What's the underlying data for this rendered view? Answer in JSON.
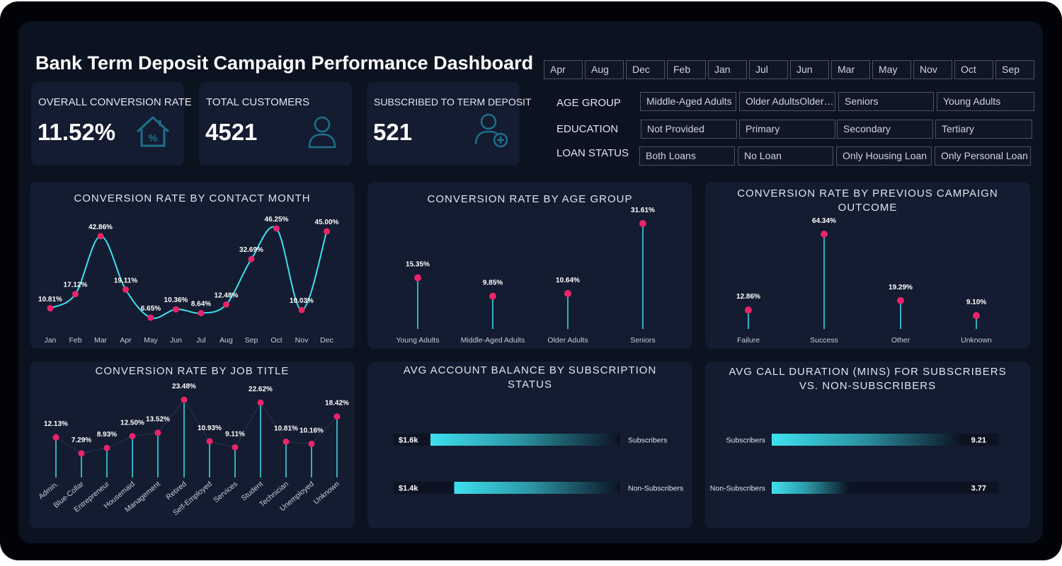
{
  "title": "Bank Term Deposit Campaign Performance Dashboard",
  "kpis": [
    {
      "label": "OVERALL CONVERSION RATE",
      "value": "11.52%",
      "icon": "house-percent-icon"
    },
    {
      "label": "TOTAL CUSTOMERS",
      "value": "4521",
      "icon": "user-icon"
    },
    {
      "label": "SUBSCRIBED TO TERM DEPOSIT",
      "value": "521",
      "icon": "user-add-icon"
    }
  ],
  "month_slicer": [
    "Apr",
    "Aug",
    "Dec",
    "Feb",
    "Jan",
    "Jul",
    "Jun",
    "Mar",
    "May",
    "Nov",
    "Oct",
    "Sep"
  ],
  "filters": {
    "age_group": {
      "label": "AGE GROUP",
      "options": [
        "Middle-Aged Adults",
        "Older AdultsOlder Adults",
        "Seniors",
        "Young Adults"
      ]
    },
    "education": {
      "label": "EDUCATION",
      "options": [
        "Not Provided",
        "Primary",
        "Secondary",
        "Tertiary"
      ]
    },
    "loan_status": {
      "label": "LOAN STATUS",
      "options": [
        "Both Loans",
        "No Loan",
        "Only Housing Loan",
        "Only Personal Loan"
      ]
    }
  },
  "colors": {
    "accent": "#3ee0ef",
    "point": "#e8246a",
    "card": "#131c30",
    "background": "#0b1220"
  },
  "chart_data": [
    {
      "id": "month",
      "type": "line",
      "title": "CONVERSION RATE BY CONTACT MONTH",
      "categories": [
        "Jan",
        "Feb",
        "Mar",
        "Apr",
        "May",
        "Jun",
        "Jul",
        "Aug",
        "Sep",
        "Oct",
        "Nov",
        "Dec"
      ],
      "values": [
        10.81,
        17.12,
        42.86,
        19.11,
        6.65,
        10.36,
        8.64,
        12.48,
        32.69,
        46.25,
        10.03,
        45.0
      ],
      "labels": [
        "10.81%",
        "17.12%",
        "42.86%",
        "19.11%",
        "6.65%",
        "10.36%",
        "8.64%",
        "12.48%",
        "32.69%",
        "46.25%",
        "10.03%",
        "45.00%"
      ]
    },
    {
      "id": "age",
      "type": "lollipop",
      "title": "CONVERSION RATE BY AGE GROUP",
      "categories": [
        "Young Adults",
        "Middle-Aged Adults",
        "Older Adults",
        "Seniors"
      ],
      "values": [
        15.35,
        9.85,
        10.64,
        31.61
      ],
      "labels": [
        "15.35%",
        "9.85%",
        "10.64%",
        "31.61%"
      ]
    },
    {
      "id": "outcome",
      "type": "lollipop",
      "title": "CONVERSION RATE BY PREVIOUS CAMPAIGN\nOUTCOME",
      "categories": [
        "Failure",
        "Success",
        "Other",
        "Unknown"
      ],
      "values": [
        12.86,
        64.34,
        19.29,
        9.1
      ],
      "labels": [
        "12.86%",
        "64.34%",
        "19.29%",
        "9.10%"
      ]
    },
    {
      "id": "job",
      "type": "lollipop",
      "title": "CONVERSION RATE BY JOB TITLE",
      "categories": [
        "Admin.",
        "Blue-Collar",
        "Entrepreneur",
        "Housemaid",
        "Management",
        "Retired",
        "Self-Employed",
        "Services",
        "Student",
        "Technician",
        "Unemployed",
        "Unknown"
      ],
      "values": [
        12.13,
        7.29,
        8.93,
        12.5,
        13.52,
        23.48,
        10.93,
        9.11,
        22.62,
        10.81,
        10.16,
        18.42
      ],
      "labels": [
        "12.13%",
        "7.29%",
        "8.93%",
        "12.50%",
        "13.52%",
        "23.48%",
        "10.93%",
        "9.11%",
        "22.62%",
        "10.81%",
        "10.16%",
        "18.42%"
      ]
    },
    {
      "id": "balance",
      "type": "bar",
      "title": "AVG ACCOUNT BALANCE BY SUBSCRIPTION\nSTATUS",
      "categories": [
        "Subscribers",
        "Non-Subscribers"
      ],
      "values": [
        1.6,
        1.4
      ],
      "labels": [
        "$1.6k",
        "$1.4k"
      ],
      "unit": "k$"
    },
    {
      "id": "duration",
      "type": "bar",
      "title": "AVG CALL DURATION (MINS) FOR SUBSCRIBERS\nVS. NON-SUBSCRIBERS",
      "categories": [
        "Subscribers",
        "Non-Subscribers"
      ],
      "values": [
        9.21,
        3.77
      ],
      "labels": [
        "9.21",
        "3.77"
      ]
    }
  ]
}
